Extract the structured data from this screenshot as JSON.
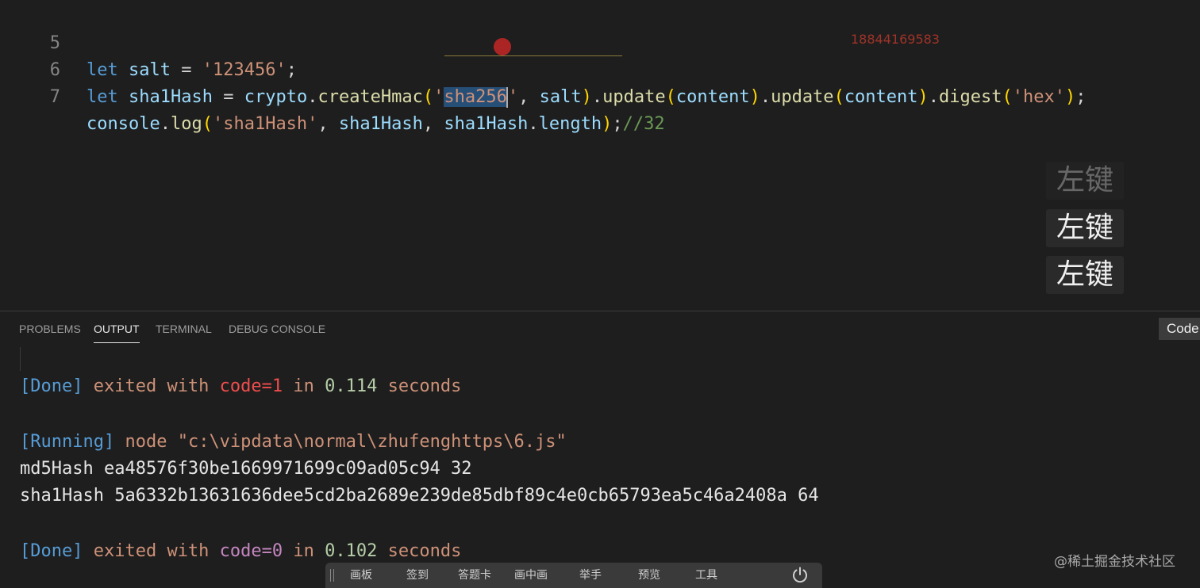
{
  "editor": {
    "lines": [
      {
        "num": "5",
        "parts": {
          "p1": "let",
          "p2": " salt",
          "p3": " = ",
          "p4": "'123456'",
          "p5": ";"
        }
      },
      {
        "num": "6"
      },
      {
        "num": "7"
      }
    ],
    "line6": {
      "let": "let",
      "name": " sha1Hash",
      "eq": " = ",
      "obj": "crypto",
      "dot1": ".",
      "fn1": "createHmac",
      "open1": "(",
      "q1": "'",
      "sel": "sha256",
      "q2": "'",
      "comma": ", ",
      "salt": "salt",
      "close1": ")",
      "dot2": ".",
      "fn2": "update",
      "open2": "(",
      "arg2": "content",
      "close2": ")",
      "dot3": ".",
      "fn3": "update",
      "open3": "(",
      "arg3": "content",
      "close3": ")",
      "dot4": ".",
      "fn4": "digest",
      "open4": "(",
      "arg4": "'hex'",
      "close4": ")",
      "semi": ";"
    },
    "line7": {
      "obj": "console",
      "dot1": ".",
      "fn": "log",
      "open": "(",
      "str": "'sha1Hash'",
      "c1": ", ",
      "v1": "sha1Hash",
      "c2": ", ",
      "v2": "sha1Hash",
      "dot2": ".",
      "prop": "length",
      "close": ")",
      "semi": ";",
      "comment": "//32"
    },
    "watermark_number": "18844169583"
  },
  "key_badges": [
    "左键",
    "左键",
    "左键"
  ],
  "panel": {
    "tabs": [
      {
        "label": "PROBLEMS",
        "active": false
      },
      {
        "label": "OUTPUT",
        "active": true
      },
      {
        "label": "TERMINAL",
        "active": false
      },
      {
        "label": "DEBUG CONSOLE",
        "active": false
      }
    ],
    "channel_select": "Code"
  },
  "output": {
    "done1": {
      "tag": "[Done]",
      "text1": " exited with ",
      "code": "code=1",
      "text2": " in ",
      "time": "0.114",
      "text3": " seconds"
    },
    "running": {
      "tag": "[Running]",
      "text1": " node ",
      "path": "\"c:\\vipdata\\normal\\zhufenghttps\\6.js\""
    },
    "md5": "md5Hash ea48576f30be1669971699c09ad05c94 32",
    "sha1": "sha1Hash 5a6332b13631636dee5cd2ba2689e239de85dbf89c4e0cb65793ea5c46a2408a 64",
    "done2": {
      "tag": "[Done]",
      "text1": " exited with ",
      "code": "code=0",
      "text2": " in ",
      "time": "0.102",
      "text3": " seconds"
    }
  },
  "toolbar": {
    "items": [
      "画板",
      "签到",
      "答题卡",
      "画中画",
      "举手",
      "预览",
      "工具"
    ]
  },
  "credit": "@稀土掘金技术社区",
  "colors": {
    "background": "#1e1e1e",
    "keyword": "#569cd6",
    "string": "#ce9178",
    "function": "#dcdcaa",
    "variable": "#9cdcfe",
    "comment": "#6a9955",
    "selection": "#264f78"
  }
}
